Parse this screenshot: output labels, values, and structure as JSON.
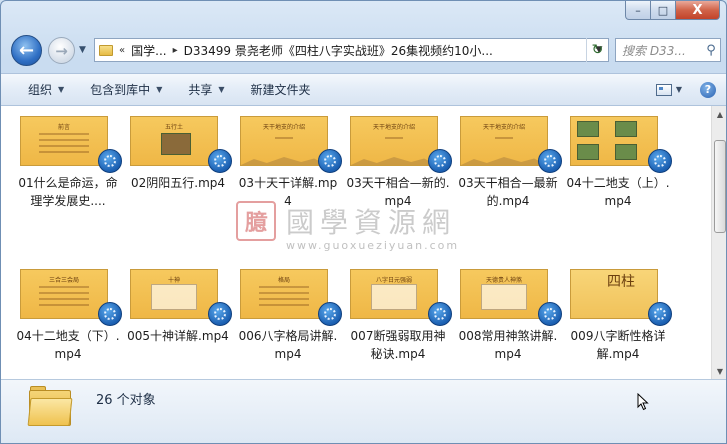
{
  "window": {
    "caption": {
      "minimize": "–",
      "maximize": "□",
      "close": "X"
    }
  },
  "nav": {
    "back": "←",
    "forward": "→",
    "recent": "▼",
    "address": {
      "overflow": "«",
      "segment1": "国学...",
      "segment2": "D33499 景尧老师《四柱八字实战班》26集视频约10小...",
      "dropdown": "▼"
    },
    "refresh": "↻",
    "search": {
      "placeholder": "搜索 D33..."
    }
  },
  "toolbar": {
    "organize": "组织",
    "include_library": "包含到库中",
    "share": "共享",
    "new_folder": "新建文件夹",
    "arrow": "▼",
    "help": "?"
  },
  "files": [
    {
      "name": "01什么是命运，命理学发展史....",
      "thumb_title": "前言",
      "style": "text"
    },
    {
      "name": "02阴阳五行.mp4",
      "thumb_title": "五行土",
      "style": "photo"
    },
    {
      "name": "03十天干详解.mp4",
      "thumb_title": "天干地支的介绍",
      "style": "hills"
    },
    {
      "name": "03天干相合—新的.mp4",
      "thumb_title": "天干地支的介绍",
      "style": "hills"
    },
    {
      "name": "03天干相合—最新的.mp4",
      "thumb_title": "天干地支的介绍",
      "style": "hills"
    },
    {
      "name": "04十二地支（上）.mp4",
      "thumb_title": "",
      "style": "photos"
    },
    {
      "name": "04十二地支（下）.mp4",
      "thumb_title": "三合三会局",
      "style": "text"
    },
    {
      "name": "005十神详解.mp4",
      "thumb_title": "十神",
      "style": "table"
    },
    {
      "name": "006八字格局讲解.mp4",
      "thumb_title": "格局",
      "style": "text"
    },
    {
      "name": "007断强弱取用神秘诀.mp4",
      "thumb_title": "八字日元强弱",
      "style": "grid"
    },
    {
      "name": "008常用神煞讲解.mp4",
      "thumb_title": "天德贵人神煞",
      "style": "table"
    },
    {
      "name": "009八字断性格详解.mp4",
      "thumb_title": "四柱",
      "style": "big"
    }
  ],
  "watermark": {
    "seal": "臆",
    "main": "國學資源網",
    "url": "www.guoxueziyuan.com"
  },
  "details": {
    "count": "26 个对象"
  },
  "scrollbar": {
    "up": "▲",
    "down": "▼"
  }
}
